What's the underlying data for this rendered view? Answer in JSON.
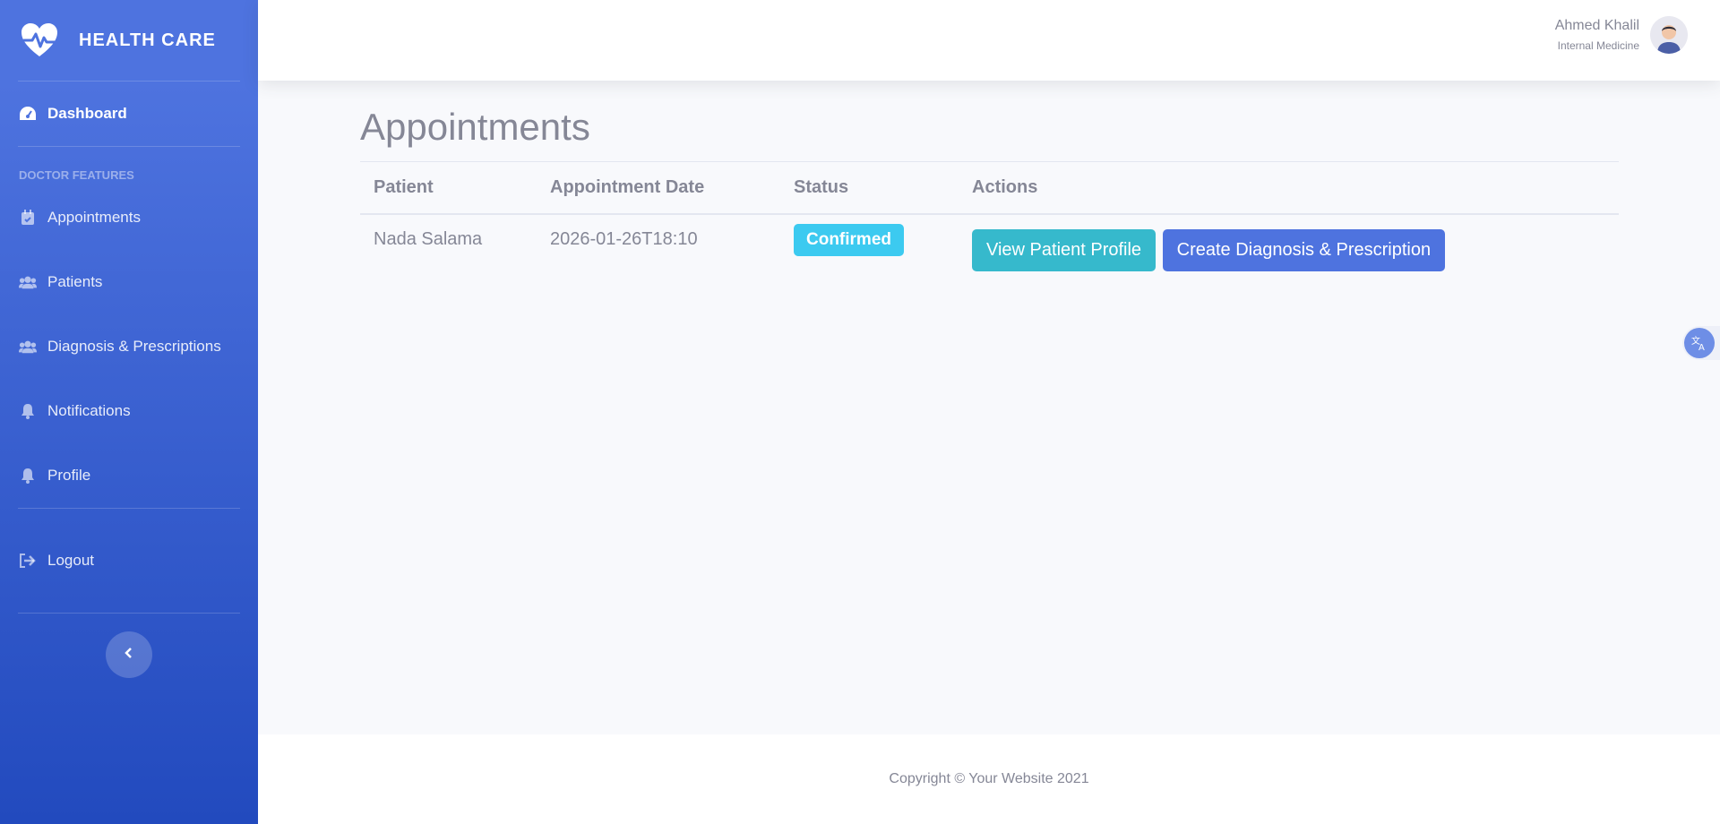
{
  "brand": {
    "name": "HEALTH CARE"
  },
  "sidebar": {
    "dashboard": "Dashboard",
    "section_heading": "DOCTOR FEATURES",
    "items": [
      {
        "label": "Appointments",
        "icon": "calendar-check-icon"
      },
      {
        "label": "Patients",
        "icon": "users-icon"
      },
      {
        "label": "Diagnosis & Prescriptions",
        "icon": "users-icon"
      },
      {
        "label": "Notifications",
        "icon": "bell-icon"
      },
      {
        "label": "Profile",
        "icon": "bell-icon"
      }
    ],
    "logout": "Logout"
  },
  "user": {
    "name": "Ahmed Khalil",
    "role": "Internal Medicine"
  },
  "main": {
    "title": "Appointments",
    "table": {
      "headers": [
        "Patient",
        "Appointment Date",
        "Status",
        "Actions"
      ],
      "rows": [
        {
          "patient": "Nada Salama",
          "date": "2026-01-26T18:10",
          "status": "Confirmed",
          "actions": {
            "view": "View Patient Profile",
            "create": "Create Diagnosis & Prescription"
          }
        }
      ]
    }
  },
  "footer": {
    "copyright": "Copyright © Your Website 2021"
  },
  "colors": {
    "sidebar_start": "#4e73df",
    "sidebar_end": "#224abe",
    "info": "#36b9cc",
    "primary": "#4e73df",
    "badge": "#3ccaf0"
  }
}
